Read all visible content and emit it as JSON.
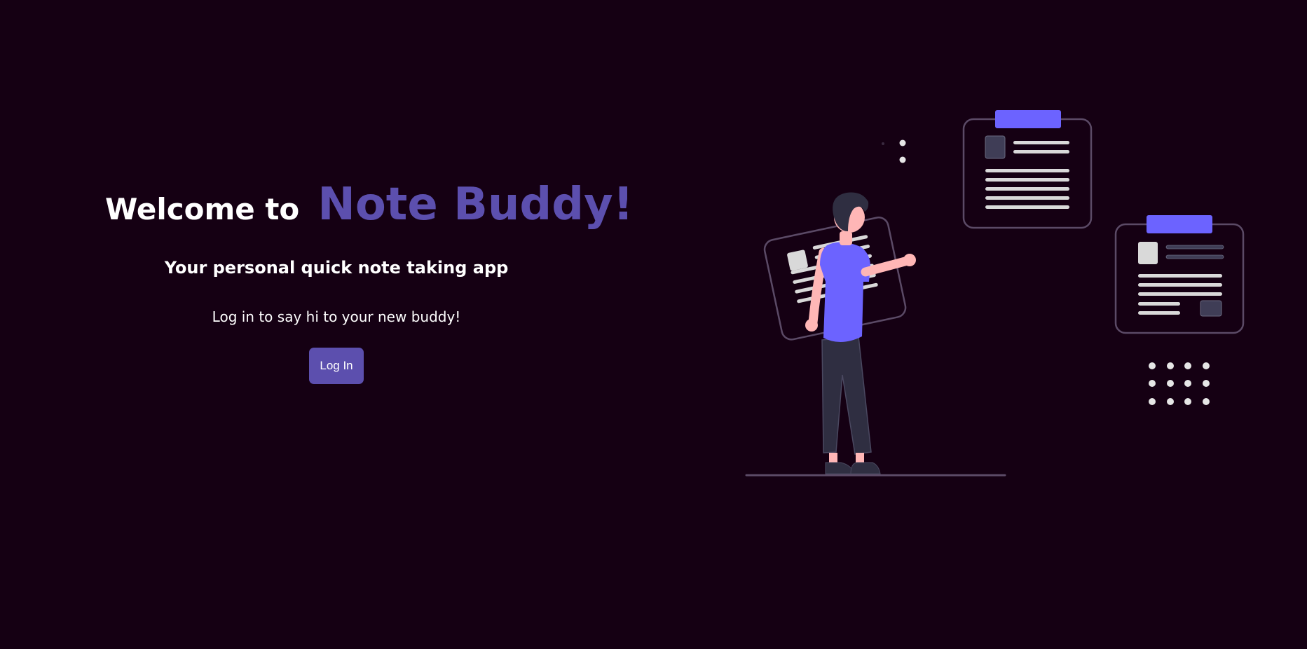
{
  "hero": {
    "welcome_text": "Welcome to",
    "brand_name": "Note Buddy!",
    "subtitle": "Your personal quick note taking app",
    "prompt": "Log in to say hi to your new buddy!",
    "login_label": "Log In"
  },
  "theme": {
    "background": "#150013",
    "accent": "#5c4fae",
    "illustration_accent": "#6c63ff"
  },
  "illustration": {
    "icon": "person-with-notes-illustration"
  }
}
